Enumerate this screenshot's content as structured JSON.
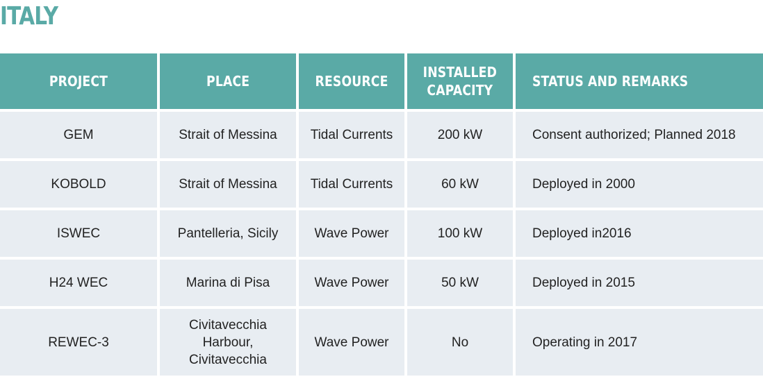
{
  "title": "ITALY",
  "table": {
    "headers": [
      "PROJECT",
      "PLACE",
      "RESOURCE",
      "INSTALLED CAPACITY",
      "STATUS AND REMARKS"
    ],
    "header_capacity_line1": "INSTALLED",
    "header_capacity_line2": "CAPACITY",
    "rows": [
      {
        "project": "GEM",
        "place": "Strait of Messina",
        "resource": "Tidal Currents",
        "capacity": "200 kW",
        "status": "Consent authorized; Planned 2018"
      },
      {
        "project": "KOBOLD",
        "place": "Strait of Messina",
        "resource": "Tidal Currents",
        "capacity": "60 kW",
        "status": "Deployed in 2000"
      },
      {
        "project": "ISWEC",
        "place": "Pantelleria, Sicily",
        "resource": "Wave Power",
        "capacity": "100 kW",
        "status": "Deployed in2016"
      },
      {
        "project": "H24 WEC",
        "place": "Marina di Pisa",
        "resource": "Wave Power",
        "capacity": "50 kW",
        "status": "Deployed in 2015"
      },
      {
        "project": "REWEC-3",
        "place": "Civitavecchia Harbour, Civitavecchia",
        "place_lines": [
          "Civitavecchia",
          "Harbour,",
          "Civitavecchia"
        ],
        "resource": "Wave Power",
        "capacity": "No",
        "status": "Operating in 2017"
      }
    ]
  },
  "colors": {
    "accent": "#5aaaa6",
    "row_background": "#e8edf2",
    "text": "#222222"
  }
}
